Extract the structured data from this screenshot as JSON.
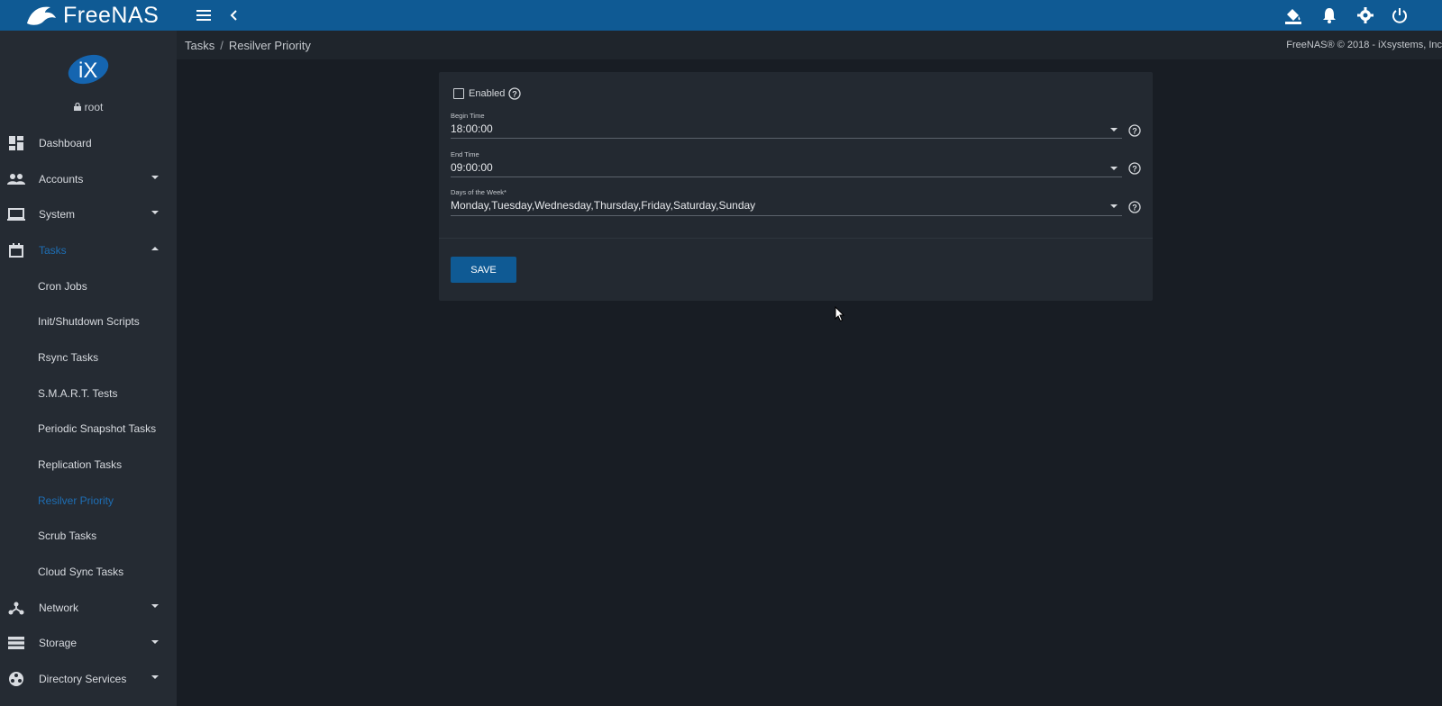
{
  "app": {
    "name": "FreeNAS"
  },
  "topbar": {
    "icons": [
      "menu-icon",
      "back-chevron-icon",
      "theme-paint-bucket-icon",
      "bell-icon",
      "gear-icon",
      "power-icon"
    ]
  },
  "user": {
    "name": "root"
  },
  "sidebar": {
    "items": [
      {
        "label": "Dashboard",
        "icon": "dashboard-icon"
      },
      {
        "label": "Accounts",
        "icon": "people-icon"
      },
      {
        "label": "System",
        "icon": "laptop-icon"
      },
      {
        "label": "Tasks",
        "icon": "calendar-icon"
      },
      {
        "label": "Cron Jobs"
      },
      {
        "label": "Init/Shutdown Scripts"
      },
      {
        "label": "Rsync Tasks"
      },
      {
        "label": "S.M.A.R.T. Tests"
      },
      {
        "label": "Periodic Snapshot Tasks"
      },
      {
        "label": "Replication Tasks"
      },
      {
        "label": "Resilver Priority"
      },
      {
        "label": "Scrub Tasks"
      },
      {
        "label": "Cloud Sync Tasks"
      },
      {
        "label": "Network",
        "icon": "network-icon"
      },
      {
        "label": "Storage",
        "icon": "storage-icon"
      },
      {
        "label": "Directory Services",
        "icon": "directory-icon"
      }
    ]
  },
  "breadcrumb": {
    "parent": "Tasks",
    "separator": "/",
    "current": "Resilver Priority"
  },
  "copyright": "FreeNAS® © 2018 - iXsystems, Inc",
  "form": {
    "enabled_label": "Enabled",
    "enabled_checked": false,
    "begin_time": {
      "label": "Begin Time",
      "value": "18:00:00"
    },
    "end_time": {
      "label": "End Time",
      "value": "09:00:00"
    },
    "days": {
      "label": "Days of the Week*",
      "value": "Monday,Tuesday,Wednesday,Thursday,Friday,Saturday,Sunday"
    },
    "save_label": "SAVE"
  },
  "colors": {
    "topbar": "#0f5a94",
    "accent": "#1e6eb4",
    "background": "#181d24",
    "sidebar": "#252b33"
  }
}
